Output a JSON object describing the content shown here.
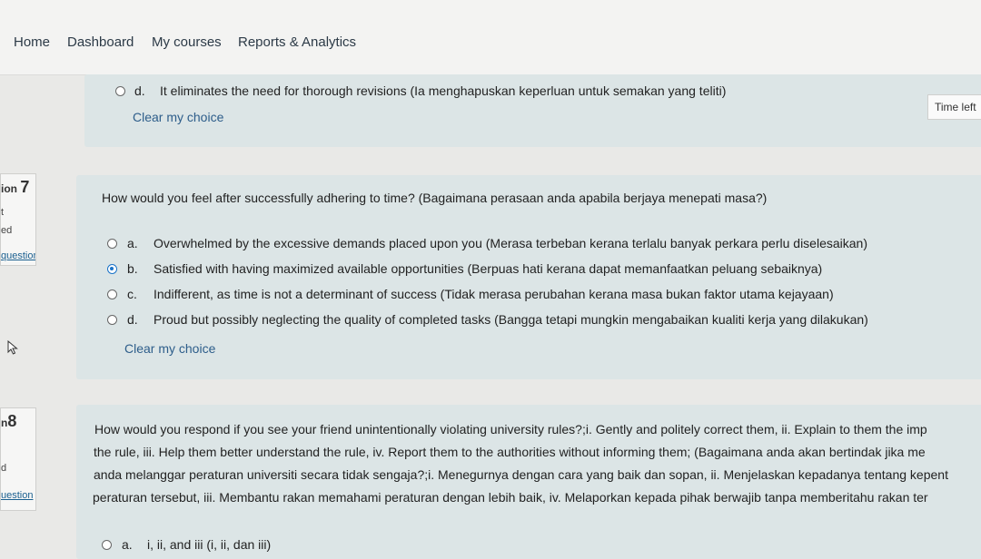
{
  "nav": {
    "items": [
      "Home",
      "Dashboard",
      "My courses",
      "Reports & Analytics"
    ]
  },
  "timer": {
    "label": "Time left"
  },
  "q6": {
    "option_d": {
      "letter": "d.",
      "text": "It eliminates the need for thorough revisions (Ia menghapuskan keperluan untuk semakan yang teliti)",
      "selected": false
    },
    "clear_label": "Clear my choice"
  },
  "q7": {
    "info": {
      "prefix": "ion",
      "number": "7",
      "state_top": "t",
      "state": "ed",
      "flag": "question"
    },
    "text": "How would you feel after successfully adhering to time? (Bagaimana perasaan anda apabila berjaya menepati masa?)",
    "options": [
      {
        "letter": "a.",
        "text": "Overwhelmed by the excessive demands placed upon you (Merasa terbeban kerana terlalu banyak perkara perlu diselesaikan)",
        "selected": false
      },
      {
        "letter": "b.",
        "text": "Satisfied with having maximized available opportunities (Berpuas hati kerana dapat memanfaatkan peluang sebaiknya)",
        "selected": true
      },
      {
        "letter": "c.",
        "text": "Indifferent, as time is not a determinant of success (Tidak merasa perubahan kerana masa bukan faktor utama kejayaan)",
        "selected": false
      },
      {
        "letter": "d.",
        "text": "Proud but possibly neglecting the quality of completed tasks (Bangga tetapi mungkin mengabaikan kualiti kerja yang dilakukan)",
        "selected": false
      }
    ],
    "clear_label": "Clear my choice"
  },
  "q8": {
    "info": {
      "prefix": "n",
      "number": "8",
      "state": "d",
      "flag": "uestion"
    },
    "lines": [
      "How would you respond if you see your friend unintentionally violating university rules?;i. Gently and politely correct them, ii. Explain to them the imp",
      "the rule, iii. Help them better understand the rule, iv. Report them to the authorities without informing them; (Bagaimana anda akan bertindak jika me",
      "anda melanggar peraturan universiti secara tidak sengaja?;i. Menegurnya dengan cara yang baik dan sopan, ii. Menjelaskan kepadanya tentang kepent",
      "peraturan tersebut, iii. Membantu rakan memahami peraturan dengan lebih baik, iv. Melaporkan kepada pihak berwajib tanpa memberitahu rakan ter"
    ],
    "options": [
      {
        "letter": "a.",
        "text": "i, ii, and iii (i, ii, dan iii)",
        "selected": false
      }
    ]
  }
}
